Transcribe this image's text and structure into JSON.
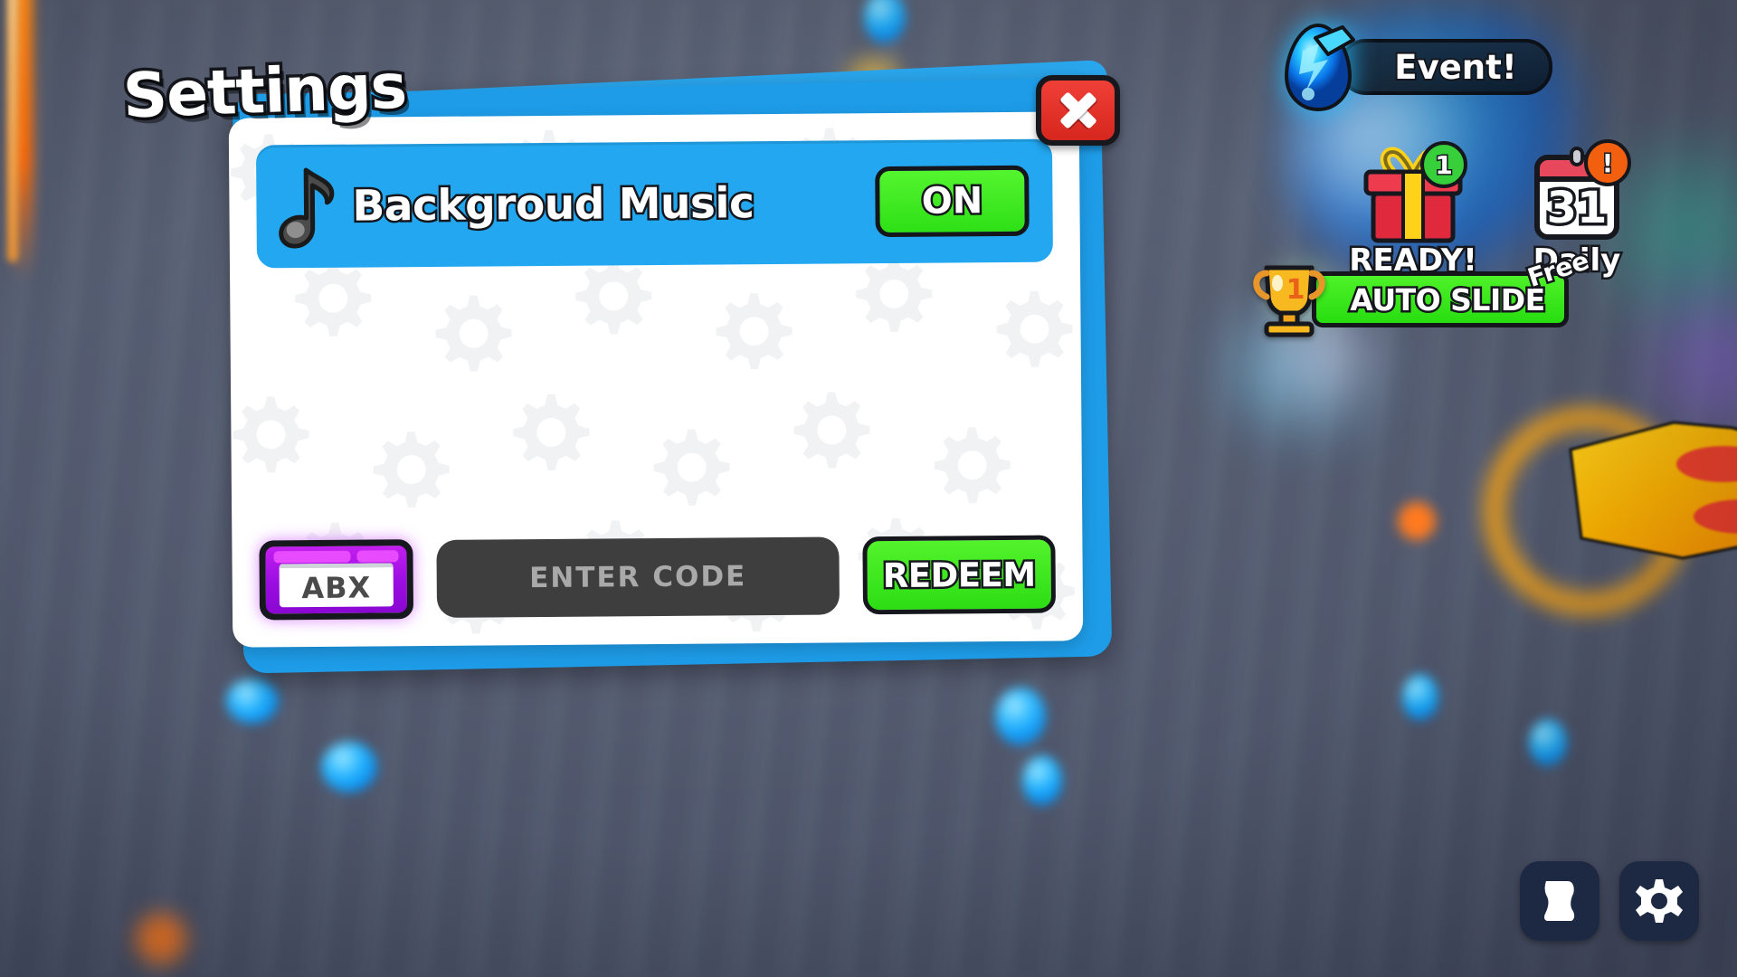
{
  "background": {
    "base_color": "#5a6278",
    "accent_orange": "#ff7a0a",
    "blob_color": "#29b6ff"
  },
  "settings_panel": {
    "title": "Settings",
    "panel_blue": "#1e9ce8",
    "panel_white": "#ffffff",
    "close_label": "close-icon",
    "rows": [
      {
        "icon": "music-note-icon",
        "label": "Backgroud Music",
        "toggle_value": "ON",
        "toggle_color": "#2ee016",
        "row_color": "#22a7f0"
      }
    ],
    "code_bar": {
      "keyboard_label": "ABX",
      "keyboard_color": "#9a0de0",
      "input_placeholder": "ENTER CODE",
      "input_value": "",
      "input_color": "#3e3e3e",
      "redeem_label": "REDEEM",
      "redeem_color": "#2ddd14"
    }
  },
  "hud": {
    "event": {
      "label": "Event!",
      "icon": "crystal-egg-icon"
    },
    "gift": {
      "caption": "READY!",
      "badge": "1",
      "badge_color": "#37cf3a",
      "icon": "gift-box-icon"
    },
    "daily": {
      "caption": "Daily",
      "day_number": "31",
      "badge": "!",
      "badge_color": "#f2600f",
      "icon": "calendar-icon"
    },
    "auto_slide": {
      "label": "AUTO SLIDE",
      "tag": "Free",
      "rank": "1",
      "icon": "trophy-icon",
      "color": "#27dd10"
    }
  },
  "corner_buttons": [
    {
      "name": "scroll-icon",
      "label": "scroll"
    },
    {
      "name": "gear-icon",
      "label": "settings"
    }
  ]
}
